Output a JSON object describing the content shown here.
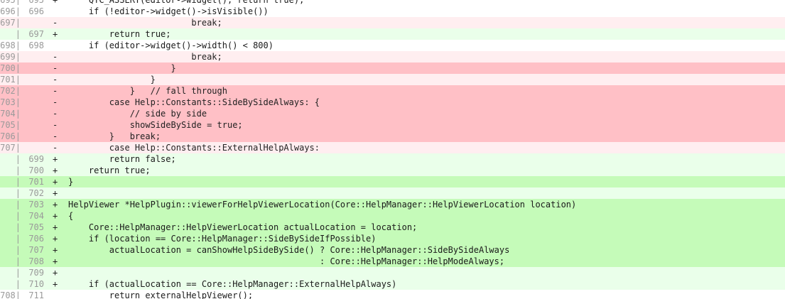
{
  "diff": {
    "lines": [
      {
        "type": "ctx",
        "old": "695",
        "new": "695",
        "mark": "+",
        "code": "    QTC_ASSERT(editor->widget(), return true);"
      },
      {
        "type": "ctx",
        "old": "696",
        "new": "696",
        "mark": "",
        "code": "    if (!editor->widget()->isVisible())"
      },
      {
        "type": "del",
        "old": "697",
        "new": "",
        "mark": "-",
        "code": "                        break;"
      },
      {
        "type": "add",
        "old": "",
        "new": "697",
        "mark": "+",
        "code": "        return true;"
      },
      {
        "type": "ctx",
        "old": "698",
        "new": "698",
        "mark": "",
        "code": "    if (editor->widget()->width() < 800)"
      },
      {
        "type": "del",
        "old": "699",
        "new": "",
        "mark": "-",
        "code": "                        break;"
      },
      {
        "type": "del-strong",
        "old": "700",
        "new": "",
        "mark": "-",
        "code": "                    }"
      },
      {
        "type": "del",
        "old": "701",
        "new": "",
        "mark": "-",
        "code": "                }"
      },
      {
        "type": "del-strong",
        "old": "702",
        "new": "",
        "mark": "-",
        "code": "            }   // fall through"
      },
      {
        "type": "del-strong",
        "old": "703",
        "new": "",
        "mark": "-",
        "code": "        case Help::Constants::SideBySideAlways: {"
      },
      {
        "type": "del-strong",
        "old": "704",
        "new": "",
        "mark": "-",
        "code": "            // side by side"
      },
      {
        "type": "del-strong",
        "old": "705",
        "new": "",
        "mark": "-",
        "code": "            showSideBySide = true;"
      },
      {
        "type": "del-strong",
        "old": "706",
        "new": "",
        "mark": "-",
        "code": "        }   break;"
      },
      {
        "type": "del",
        "old": "707",
        "new": "",
        "mark": "-",
        "code": "        case Help::Constants::ExternalHelpAlways:"
      },
      {
        "type": "add",
        "old": "",
        "new": "699",
        "mark": "+",
        "code": "        return false;"
      },
      {
        "type": "add",
        "old": "",
        "new": "700",
        "mark": "+",
        "code": "    return true;"
      },
      {
        "type": "add-strong",
        "old": "",
        "new": "701",
        "mark": "+",
        "code": "}"
      },
      {
        "type": "add",
        "old": "",
        "new": "702",
        "mark": "+",
        "code": ""
      },
      {
        "type": "add-strong",
        "old": "",
        "new": "703",
        "mark": "+",
        "code": "HelpViewer *HelpPlugin::viewerForHelpViewerLocation(Core::HelpManager::HelpViewerLocation location)"
      },
      {
        "type": "add-strong",
        "old": "",
        "new": "704",
        "mark": "+",
        "code": "{"
      },
      {
        "type": "add-strong",
        "old": "",
        "new": "705",
        "mark": "+",
        "code": "    Core::HelpManager::HelpViewerLocation actualLocation = location;"
      },
      {
        "type": "add-strong",
        "old": "",
        "new": "706",
        "mark": "+",
        "code": "    if (location == Core::HelpManager::SideBySideIfPossible)"
      },
      {
        "type": "add-strong",
        "old": "",
        "new": "707",
        "mark": "+",
        "code": "        actualLocation = canShowHelpSideBySide() ? Core::HelpManager::SideBySideAlways"
      },
      {
        "type": "add-strong",
        "old": "",
        "new": "708",
        "mark": "+",
        "code": "                                                 : Core::HelpManager::HelpModeAlways;"
      },
      {
        "type": "add",
        "old": "",
        "new": "709",
        "mark": "+",
        "code": ""
      },
      {
        "type": "add",
        "old": "",
        "new": "710",
        "mark": "+",
        "code": "    if (actualLocation == Core::HelpManager::ExternalHelpAlways)"
      },
      {
        "type": "ctx",
        "old": "708",
        "new": "711",
        "mark": "",
        "code": "        return externalHelpViewer();"
      }
    ]
  }
}
